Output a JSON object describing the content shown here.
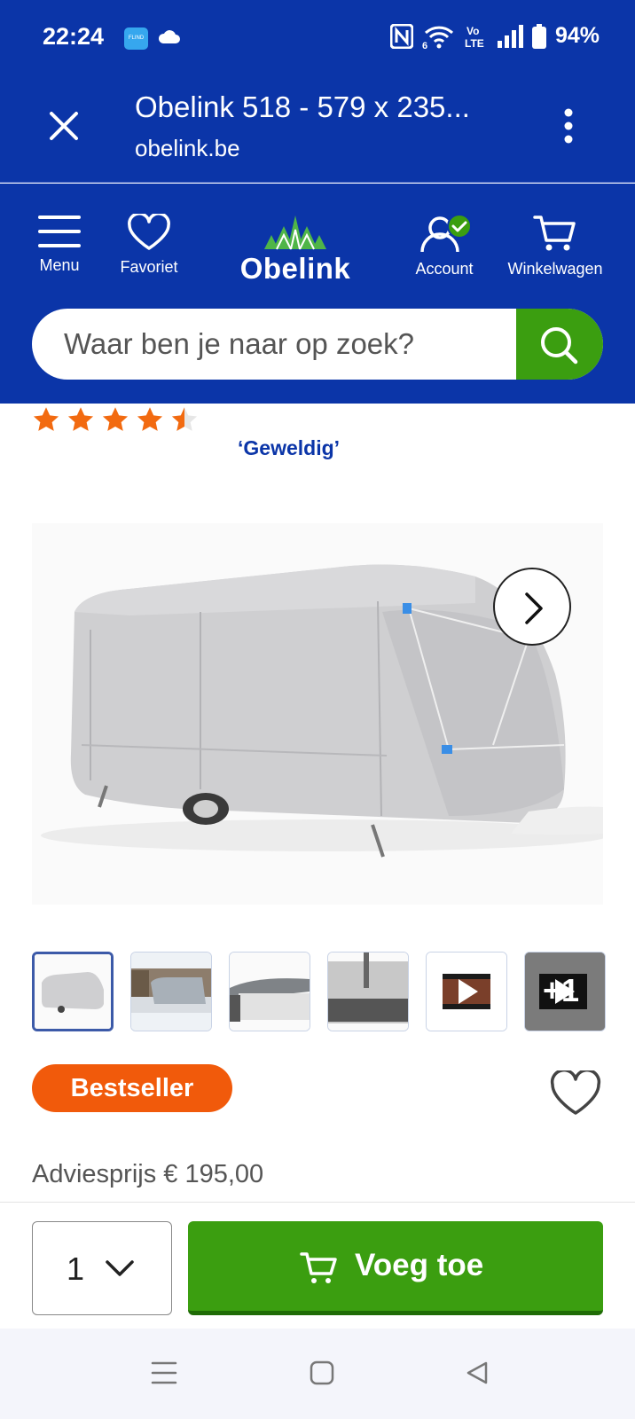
{
  "status_bar": {
    "time": "22:24",
    "app_icon_label": "FLIND",
    "battery": "94%",
    "icons": [
      "cloud-icon",
      "nfc-icon",
      "wifi-6-icon",
      "volte-icon",
      "signal-icon",
      "battery-icon"
    ]
  },
  "browser": {
    "title": "Obelink 518 - 579 x 235...",
    "url": "obelink.be"
  },
  "header": {
    "menu_label": "Menu",
    "favorites_label": "Favoriet",
    "logo_text": "Obelink",
    "account_label": "Account",
    "cart_label": "Winkelwagen",
    "search_placeholder": "Waar ben je naar op zoek?"
  },
  "rating": {
    "stars": 4.5,
    "label": "‘Geweldig’"
  },
  "gallery": {
    "thumbnail_count": 6,
    "active_index": 0,
    "more_label": "+1"
  },
  "product": {
    "badge": "Bestseller",
    "advice_price": "Adviesprijs € 195,00"
  },
  "cart_bar": {
    "quantity": "1",
    "add_button_label": "Voeg toe"
  },
  "colors": {
    "brand_blue": "#0b35a8",
    "action_green": "#3b9e10",
    "badge_orange": "#f15a0b",
    "star_orange": "#f26a10"
  }
}
